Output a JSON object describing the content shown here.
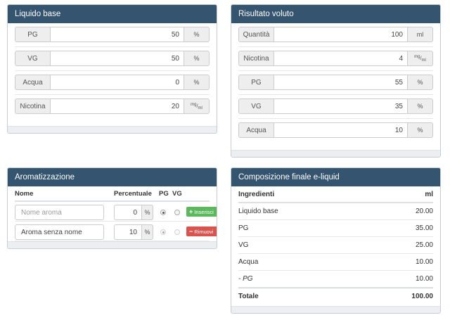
{
  "base": {
    "title": "Liquido base",
    "rows": [
      {
        "label": "PG",
        "value": "50",
        "unit": "%"
      },
      {
        "label": "VG",
        "value": "50",
        "unit": "%"
      },
      {
        "label": "Acqua",
        "value": "0",
        "unit": "%"
      },
      {
        "label": "Nicotina",
        "value": "20",
        "unit_top": "mg",
        "unit_sep": "/",
        "unit_bottom": "ml"
      }
    ]
  },
  "target": {
    "title": "Risultato voluto",
    "rows": [
      {
        "label": "Quantità",
        "value": "100",
        "unit": "ml"
      },
      {
        "label": "Nicotina",
        "value": "4",
        "unit_top": "mg",
        "unit_sep": "/",
        "unit_bottom": "ml"
      },
      {
        "label": "PG",
        "value": "55",
        "unit": "%"
      },
      {
        "label": "VG",
        "value": "35",
        "unit": "%"
      },
      {
        "label": "Acqua",
        "value": "10",
        "unit": "%"
      }
    ]
  },
  "aroma": {
    "title": "Aromatizzazione",
    "headers": {
      "name": "Nome",
      "pct": "Percentuale",
      "pg": "PG",
      "vg": "VG"
    },
    "new_row": {
      "placeholder": "Nome aroma",
      "value": "0",
      "unit": "%",
      "button": "Inserisci",
      "button_icon": "+"
    },
    "rows": [
      {
        "name": "Aroma senza nome",
        "value": "10",
        "unit": "%",
        "button": "Rimuovi",
        "button_icon": "−"
      }
    ]
  },
  "composition": {
    "title": "Composizione finale e-liquid",
    "headers": {
      "ingredient": "Ingredienti",
      "unit": "ml"
    },
    "rows": [
      {
        "name": "Liquido base",
        "value": "20.00"
      },
      {
        "name": "PG",
        "value": "35.00"
      },
      {
        "name": "VG",
        "value": "25.00"
      },
      {
        "name": "Acqua",
        "value": "10.00"
      },
      {
        "name": "- PG",
        "value": "10.00"
      }
    ],
    "total": {
      "name": "Totale",
      "value": "100.00"
    }
  }
}
